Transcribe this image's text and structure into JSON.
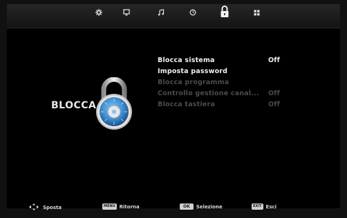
{
  "top_tabs": [
    {
      "icon": "picture-settings-icon",
      "active": false
    },
    {
      "icon": "monitor-icon",
      "active": false
    },
    {
      "icon": "music-note-icon",
      "active": false
    },
    {
      "icon": "clock-icon",
      "active": false
    },
    {
      "icon": "lock-icon",
      "active": true
    },
    {
      "icon": "grid-icon",
      "active": false
    }
  ],
  "section_title": "BLOCCA",
  "menu": {
    "items": [
      {
        "label": "Blocca sistema",
        "value": "Off",
        "enabled": true
      },
      {
        "label": "Imposta password",
        "value": "",
        "enabled": true
      },
      {
        "label": "Blocca programma",
        "value": "",
        "enabled": false
      },
      {
        "label": "Controllo gestione canal...",
        "value": "Off",
        "enabled": false
      },
      {
        "label": "Blocca tastiera",
        "value": "Off",
        "enabled": false
      }
    ]
  },
  "footer": {
    "move_icon": "arrows-icon",
    "move_label": "Sposta",
    "menu_key": "MENU",
    "return_label": "Ritorna",
    "ok_key": "OK",
    "select_label": "Selezione",
    "exit_key": "EXIT",
    "exit_label": "Esci"
  },
  "colors": {
    "accent_blue": "#3f8fd0",
    "disabled_text": "#4b4b4b",
    "enabled_text": "#f2f2f2"
  }
}
